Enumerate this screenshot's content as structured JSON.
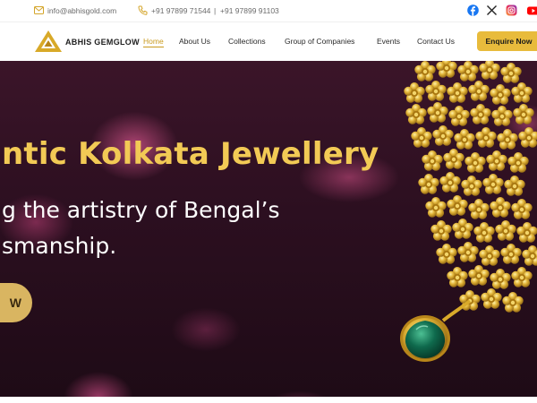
{
  "topbar": {
    "email": "info@abhisgold.com",
    "phone1": "+91 97899 71544",
    "separator": "|",
    "phone2": "+91 97899 91103",
    "icons": [
      "mail-icon",
      "phone-icon",
      "facebook-icon",
      "x-icon",
      "instagram-icon",
      "youtube-icon"
    ]
  },
  "brand": {
    "name": "ABHIS GEMGLOW",
    "gold": "#e8bb3c"
  },
  "nav": {
    "items": [
      "Home",
      "About Us",
      "Collections",
      "Group of Companies",
      "Events",
      "Contact Us"
    ],
    "active": "Home",
    "enquire_label": "Enquire Now"
  },
  "hero": {
    "title": "ntic Kolkata Jewellery",
    "line1": "g the artistry of Bengal’s",
    "line2": "smanship.",
    "cta_label": "W"
  },
  "colors": {
    "title_gold": "#f2ca55",
    "hero_dark": "#2c0f20",
    "accent_pink": "#d7558c"
  }
}
